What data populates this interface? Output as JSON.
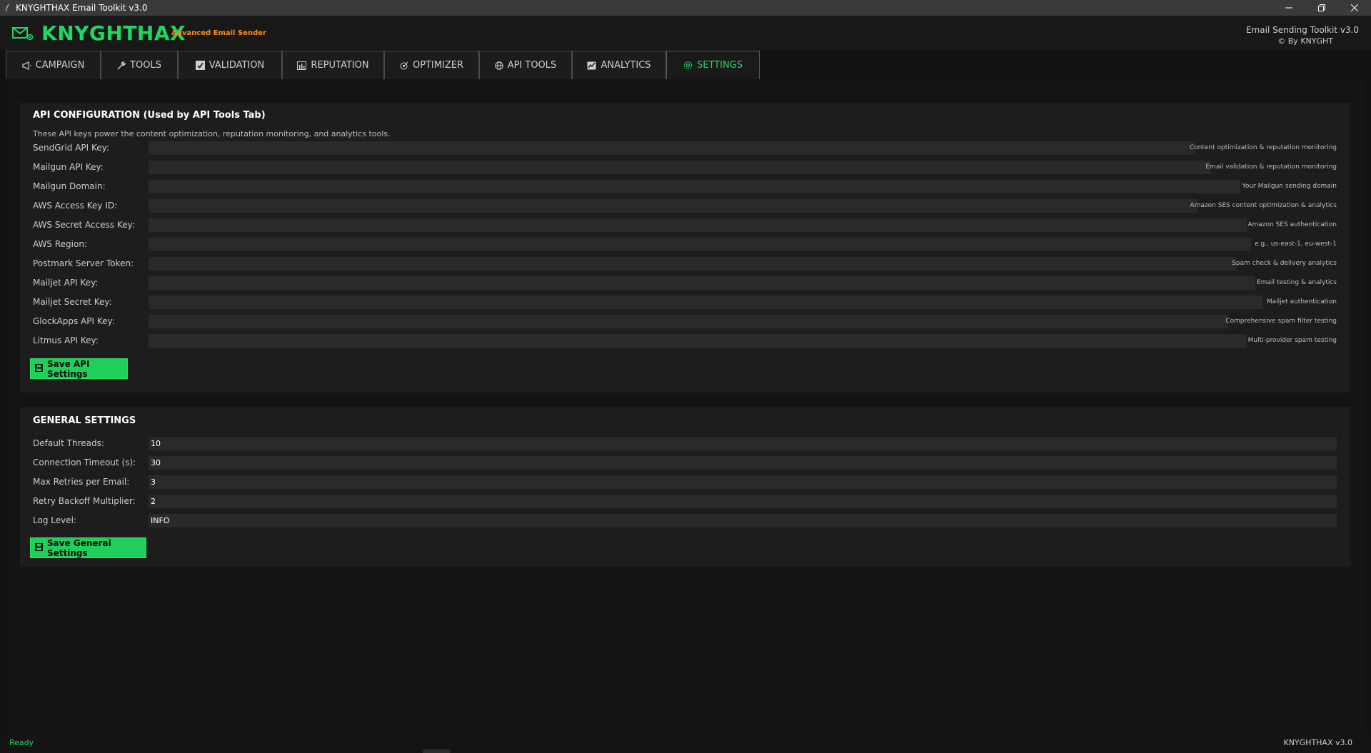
{
  "window": {
    "title": "KNYGHTHAX Email Toolkit v3.0",
    "controls": [
      "minimize",
      "restore",
      "close"
    ]
  },
  "header": {
    "logo_text": "KNYGHTHAX",
    "subtitle": "Advanced Email Sender",
    "right_title": "Email Sending Toolkit v3.0",
    "right_copyright": "© By KNYGHT"
  },
  "tabs": [
    {
      "label": "CAMPAIGN",
      "icon": "megaphone-icon"
    },
    {
      "label": "TOOLS",
      "icon": "wrench-icon"
    },
    {
      "label": "VALIDATION",
      "icon": "checkbox-icon"
    },
    {
      "label": "REPUTATION",
      "icon": "bar-chart-icon"
    },
    {
      "label": "OPTIMIZER",
      "icon": "target-icon"
    },
    {
      "label": "API TOOLS",
      "icon": "globe-icon"
    },
    {
      "label": "ANALYTICS",
      "icon": "line-chart-icon"
    },
    {
      "label": "SETTINGS",
      "icon": "gear-icon",
      "active": true
    }
  ],
  "api_config": {
    "title": "API CONFIGURATION (Used by API Tools Tab)",
    "description": "These API keys power the content optimization, reputation monitoring, and analytics tools.",
    "fields": [
      {
        "label": "SendGrid API Key:",
        "value": "",
        "hint": "Content optimization & reputation monitoring"
      },
      {
        "label": "Mailgun API Key:",
        "value": "",
        "hint": "Email validation & reputation monitoring"
      },
      {
        "label": "Mailgun Domain:",
        "value": "",
        "hint": "Your Mailgun sending domain"
      },
      {
        "label": "AWS Access Key ID:",
        "value": "",
        "hint": "Amazon SES content optimization & analytics"
      },
      {
        "label": "AWS Secret Access Key:",
        "value": "",
        "hint": "Amazon SES authentication"
      },
      {
        "label": "AWS Region:",
        "value": "",
        "hint": "e.g., us-east-1, eu-west-1"
      },
      {
        "label": "Postmark Server Token:",
        "value": "",
        "hint": "Spam check & delivery analytics"
      },
      {
        "label": "Mailjet API Key:",
        "value": "",
        "hint": "Email testing & analytics"
      },
      {
        "label": "Mailjet Secret Key:",
        "value": "",
        "hint": "Mailjet authentication"
      },
      {
        "label": "GlockApps API Key:",
        "value": "",
        "hint": "Comprehensive spam filter testing"
      },
      {
        "label": "Litmus API Key:",
        "value": "",
        "hint": "Multi-provider spam testing"
      }
    ],
    "save_label": "Save API Settings"
  },
  "general": {
    "title": "GENERAL SETTINGS",
    "fields": [
      {
        "label": "Default Threads:",
        "value": "10"
      },
      {
        "label": "Connection Timeout (s):",
        "value": "30"
      },
      {
        "label": "Max Retries per Email:",
        "value": "3"
      },
      {
        "label": "Retry Backoff Multiplier:",
        "value": "2"
      },
      {
        "label": "Log Level:",
        "value": "INFO"
      }
    ],
    "save_label": "Save General Settings"
  },
  "status": {
    "left": "Ready",
    "right": "KNYGHTHAX v3.0"
  },
  "colors": {
    "accent": "#1ed760",
    "orange": "#ff8c1a",
    "background": "#121212",
    "panel": "#1d1d1d",
    "input": "#2a2a2a"
  }
}
